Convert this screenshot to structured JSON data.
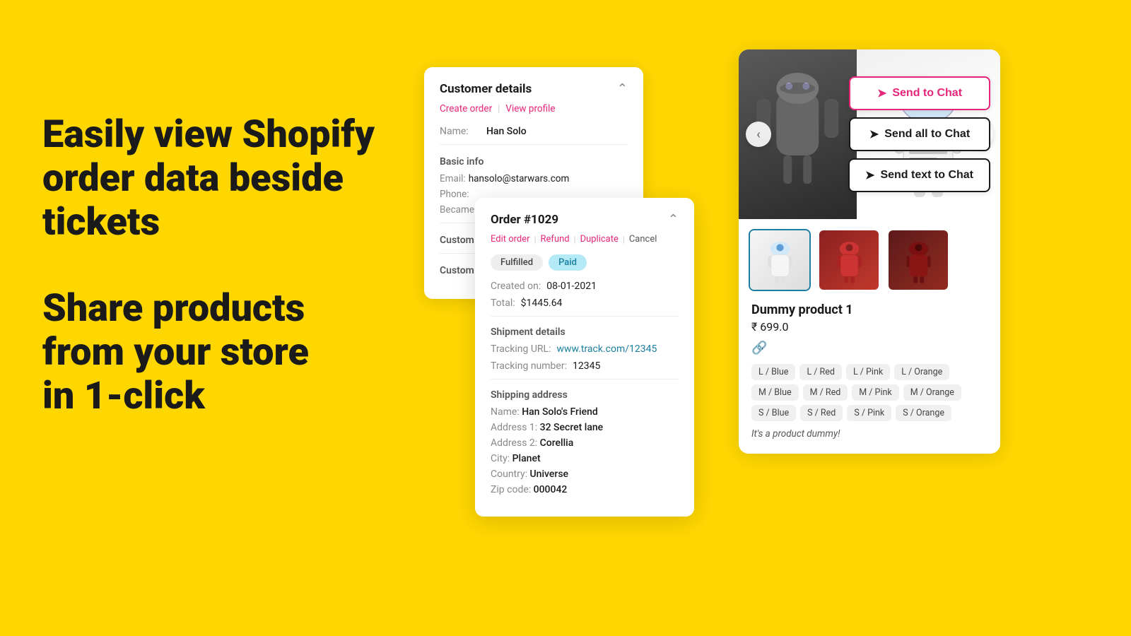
{
  "background_color": "#FFD700",
  "hero": {
    "line1": "Easily view Shopify",
    "line2": "order data beside",
    "line3": "tickets",
    "line4": "Share products",
    "line5": "from your store",
    "line6": "in 1-click"
  },
  "customer_card": {
    "title": "Customer details",
    "create_order": "Create order",
    "view_profile": "View profile",
    "name_label": "Name:",
    "name_value": "Han Solo",
    "basic_info": "Basic info",
    "email_label": "Email:",
    "email_value": "hansolo@starwars.com",
    "phone_label": "Phone:",
    "became_label": "Became",
    "custom_label1": "Custom",
    "custom_label2": "Custom"
  },
  "order_card": {
    "title": "Order #1029",
    "edit_order": "Edit order",
    "refund": "Refund",
    "duplicate": "Duplicate",
    "cancel": "Cancel",
    "badge_fulfilled": "Fulfilled",
    "badge_paid": "Paid",
    "created_label": "Created on:",
    "created_value": "08-01-2021",
    "total_label": "Total:",
    "total_value": "$1445.64",
    "shipment_title": "Shipment details",
    "tracking_url_label": "Tracking URL:",
    "tracking_url_value": "www.track.com/12345",
    "tracking_number_label": "Tracking number:",
    "tracking_number_value": "12345",
    "shipping_title": "Shipping address",
    "ship_name_label": "Name:",
    "ship_name_value": "Han Solo's Friend",
    "address1_label": "Address 1:",
    "address1_value": "32 Secret lane",
    "address2_label": "Address 2:",
    "address2_value": "Corellia",
    "city_label": "City:",
    "city_value": "Planet",
    "country_label": "Country:",
    "country_value": "Universe",
    "zip_label": "Zip code:",
    "zip_value": "000042"
  },
  "product_card": {
    "send_to_chat": "Send to Chat",
    "send_all_to_chat": "Send all to Chat",
    "send_text_to_chat": "Send text to Chat",
    "product_name": "Dummy product 1",
    "product_price": "₹ 699.0",
    "product_description": "It's a product dummy!",
    "variants": [
      "L / Blue",
      "L / Red",
      "L / Pink",
      "L / Orange",
      "M / Blue",
      "M / Red",
      "M / Pink",
      "M / Orange",
      "S / Blue",
      "S / Red",
      "S / Pink",
      "S / Orange"
    ]
  },
  "icons": {
    "chevron_up": "^",
    "nav_left": "<",
    "nav_right": ">",
    "send_arrow": "➤",
    "link": "🔗"
  }
}
